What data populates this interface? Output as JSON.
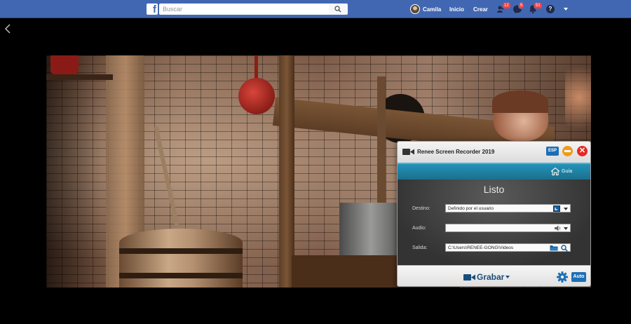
{
  "facebook": {
    "logo": "f",
    "search_placeholder": "Buscar",
    "user_name": "Camila",
    "nav_home": "Inicio",
    "nav_create": "Crear",
    "friend_requests_count": "12",
    "messages_count": "5",
    "notifications_count": "51",
    "help_label": "?",
    "brand_color": "#4267b2",
    "badge_color": "#fa3e3e"
  },
  "recorder": {
    "title": "Renee Screen Recorder 2019",
    "lang_button": "ESP",
    "close_symbol": "✕",
    "guide_label": "Guía",
    "status": "Listo",
    "destino_label": "Destino:",
    "destino_value": "Definido por el usuario",
    "audio_label": "Audio:",
    "audio_value": "",
    "salida_label": "Salida:",
    "salida_value": "C:\\Users\\RENEE-GONG\\Videos",
    "record_label": "Grabar",
    "auto_button": "Auto",
    "accent_color": "#1e6fb5",
    "header_color": "#2392b8"
  },
  "icons": {
    "back": "chevron-left-icon",
    "search": "search-icon",
    "friends": "friends-icon",
    "messages": "messenger-icon",
    "notifications": "bell-icon",
    "recorder": "video-camera-icon",
    "guide": "home-icon",
    "screen": "screen-select-icon",
    "speaker": "speaker-icon",
    "folder": "folder-icon",
    "settings": "gear-icon"
  }
}
